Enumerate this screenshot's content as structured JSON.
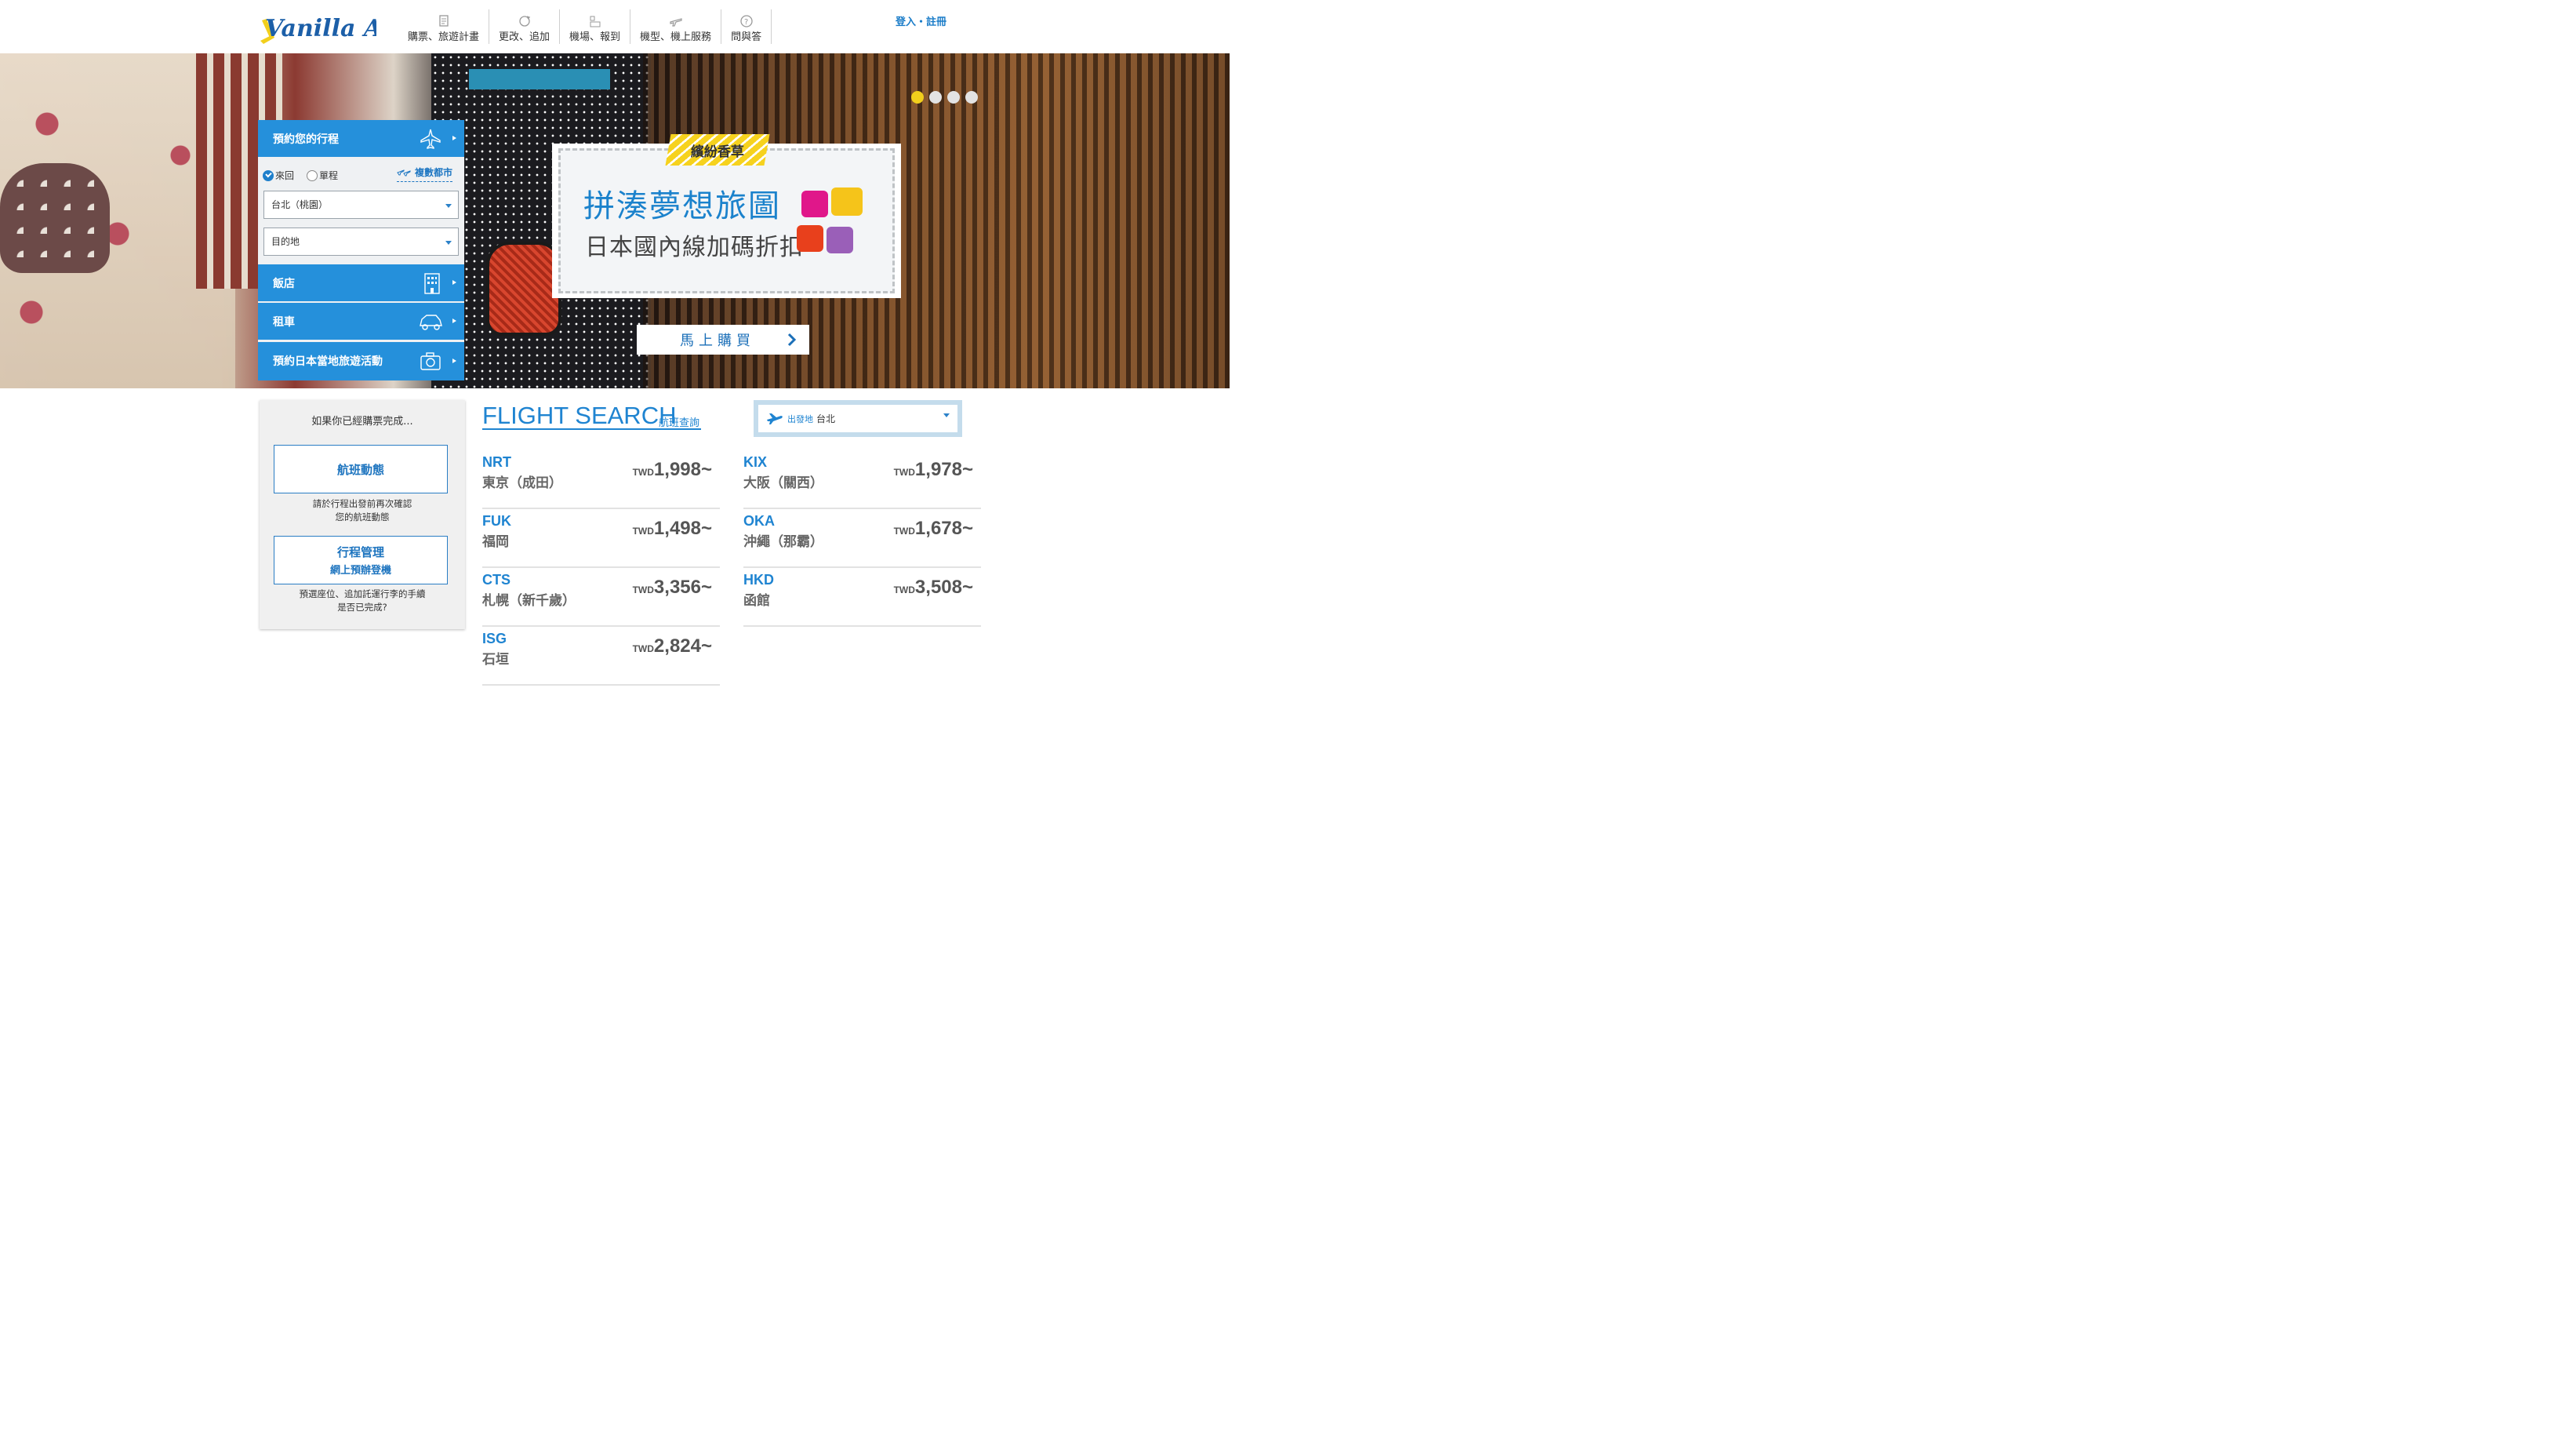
{
  "header": {
    "logo_text": "Vanilla Air",
    "nav": [
      {
        "label": "購票、旅遊計畫",
        "icon": "document-icon"
      },
      {
        "label": "更改、追加",
        "icon": "refresh-icon"
      },
      {
        "label": "機場、報到",
        "icon": "checkin-icon"
      },
      {
        "label": "機型、機上服務",
        "icon": "airplane-icon"
      },
      {
        "label": "問與答",
        "icon": "question-icon"
      }
    ],
    "login": "登入・註冊"
  },
  "hero": {
    "slides": 4,
    "active_slide": 1,
    "promo": {
      "tag": "繽紛香草",
      "title": "拼湊夢想旅圖",
      "subtitle": "日本國內線加碼折扣"
    },
    "buy_button": "馬上購買"
  },
  "booking": {
    "header": "預約您的行程",
    "round_trip": "來回",
    "one_way": "單程",
    "selected_trip": "round_trip",
    "multi_city": "複數都市",
    "origin_value": "台北（桃園）",
    "destination_placeholder": "目的地",
    "rows": [
      {
        "label": "飯店",
        "icon": "hotel-icon"
      },
      {
        "label": "租車",
        "icon": "car-icon"
      },
      {
        "label": "預約日本當地旅遊活動",
        "icon": "camera-icon"
      }
    ]
  },
  "purchased": {
    "title": "如果你已經購票完成...",
    "flight_status": "航班動態",
    "flight_status_note_1": "請於行程出發前再次確認",
    "flight_status_note_2": "您的航班動態",
    "manage_title": "行程管理",
    "manage_sub": "網上預辦登機",
    "manage_note_1": "預選座位、追加託運行李的手續",
    "manage_note_2": "是否已完成?"
  },
  "flight_search": {
    "title": "FLIGHT SEARCH",
    "subtitle": "航班查詢",
    "origin_label": "出發地",
    "origin_value": "台北",
    "currency": "TWD",
    "routes": [
      {
        "code": "NRT",
        "city": "東京（成田）",
        "price": "1,998~"
      },
      {
        "code": "KIX",
        "city": "大阪（關西）",
        "price": "1,978~"
      },
      {
        "code": "FUK",
        "city": "福岡",
        "price": "1,498~"
      },
      {
        "code": "OKA",
        "city": "沖繩（那霸）",
        "price": "1,678~"
      },
      {
        "code": "CTS",
        "city": "札幌（新千歲）",
        "price": "3,356~"
      },
      {
        "code": "HKD",
        "city": "函館",
        "price": "3,508~"
      },
      {
        "code": "ISG",
        "city": "石垣",
        "price": "2,824~"
      }
    ]
  },
  "colors": {
    "brand_blue": "#2590db",
    "link_blue": "#1f84d1",
    "accent_yellow": "#f2cf1c"
  }
}
